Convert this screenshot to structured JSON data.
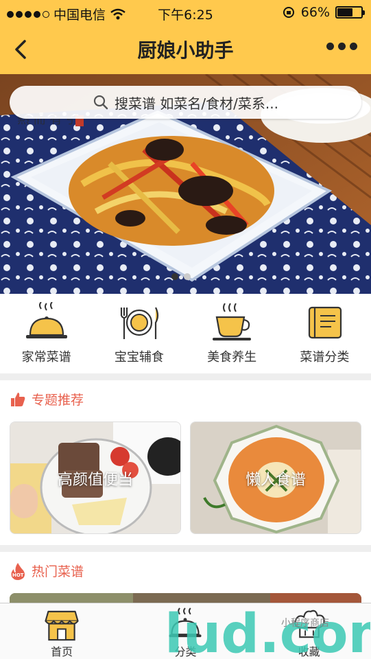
{
  "status": {
    "carrier": "中国电信",
    "time": "下午6:25",
    "battery": "66%",
    "battery_level": 0.66
  },
  "nav": {
    "title": "厨娘小助手"
  },
  "search": {
    "placeholder": "搜菜谱 如菜名/食材/菜系..."
  },
  "carousel": {
    "page_count": 2,
    "active_page": 1
  },
  "categories": [
    {
      "label": "家常菜谱",
      "icon": "cloche-icon"
    },
    {
      "label": "宝宝辅食",
      "icon": "plate-cutlery-icon"
    },
    {
      "label": "美食养生",
      "icon": "steaming-cup-icon"
    },
    {
      "label": "菜谱分类",
      "icon": "recipe-book-icon"
    }
  ],
  "topics": {
    "title": "专题推荐",
    "items": [
      {
        "title": "高颜值便当"
      },
      {
        "title": "懒人食谱"
      }
    ]
  },
  "hot": {
    "title": "热门菜谱",
    "badge": "HOT"
  },
  "tabbar": [
    {
      "label": "首页",
      "icon": "storefront-icon",
      "active": true
    },
    {
      "label": "分类",
      "icon": "cloche-icon",
      "active": false
    },
    {
      "label": "收藏",
      "icon": "chef-hat-icon",
      "active": false
    }
  ],
  "watermark": {
    "text": "lud.com",
    "sub": "小程序商店"
  },
  "colors": {
    "brand": "#ffc94d",
    "accent": "#e8614e",
    "icon_fill": "#f5c34a"
  }
}
